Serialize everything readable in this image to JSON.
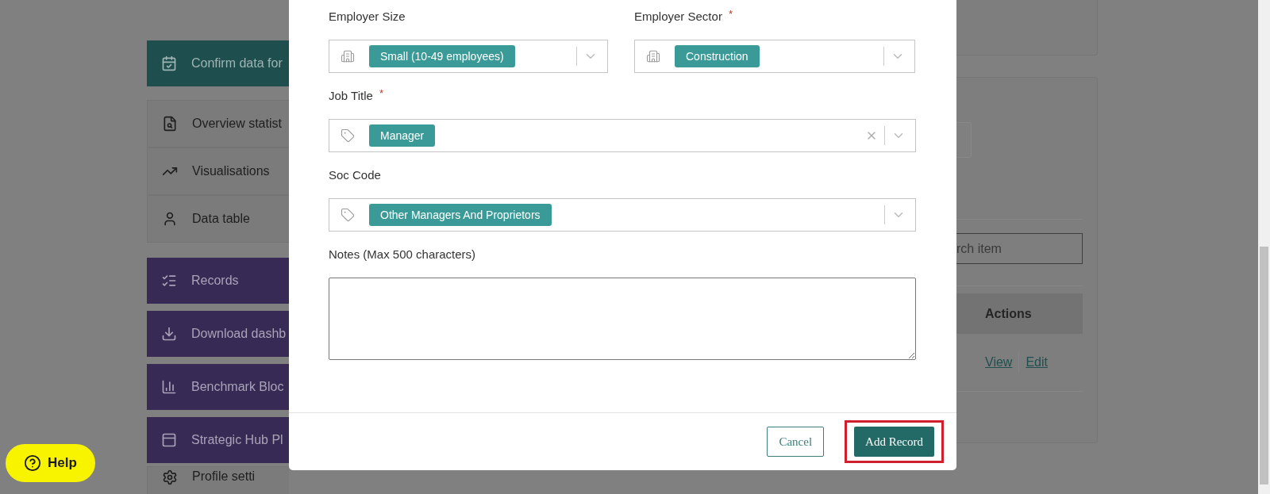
{
  "sidebar": {
    "items": [
      {
        "label": "Confirm data for",
        "kind": "highlight"
      },
      {
        "label": "Overview statist",
        "kind": "plain"
      },
      {
        "label": "Visualisations",
        "kind": "plain"
      },
      {
        "label": "Data table",
        "kind": "plain"
      },
      {
        "label": "Records",
        "kind": "action"
      },
      {
        "label": "Download dashb",
        "kind": "action"
      },
      {
        "label": "Benchmark Bloc",
        "kind": "action"
      },
      {
        "label": "Strategic Hub Pl",
        "kind": "action"
      },
      {
        "label": "Profile setti",
        "kind": "plain"
      }
    ]
  },
  "help_button": {
    "label": "Help"
  },
  "modal": {
    "fields": [
      {
        "kind": "select",
        "label": "Employer Size",
        "value": "Small (10-49 employees)",
        "clearable": false
      },
      {
        "kind": "select",
        "label": "Employer Sector",
        "required_mark": "*",
        "value": "Construction",
        "clearable": false
      },
      {
        "kind": "select",
        "label": "Job Title",
        "required_mark": "*",
        "value": "Manager",
        "clearable": true
      },
      {
        "kind": "select",
        "label": "Soc Code",
        "value": "Other Managers And Proprietors",
        "clearable": false
      },
      {
        "kind": "textarea",
        "label": "Notes (Max 500 characters)"
      }
    ],
    "buttons": [
      {
        "label": "Cancel",
        "kind": "secondary",
        "highlighted": false
      },
      {
        "label": "Add Record",
        "kind": "primary",
        "highlighted": true
      }
    ]
  },
  "background_panel": {
    "search": {
      "placeholder": "rch item"
    },
    "table": {
      "columns": [
        "Actions"
      ],
      "rows": [
        {
          "actions": [
            "View",
            "Edit"
          ]
        }
      ]
    }
  }
}
